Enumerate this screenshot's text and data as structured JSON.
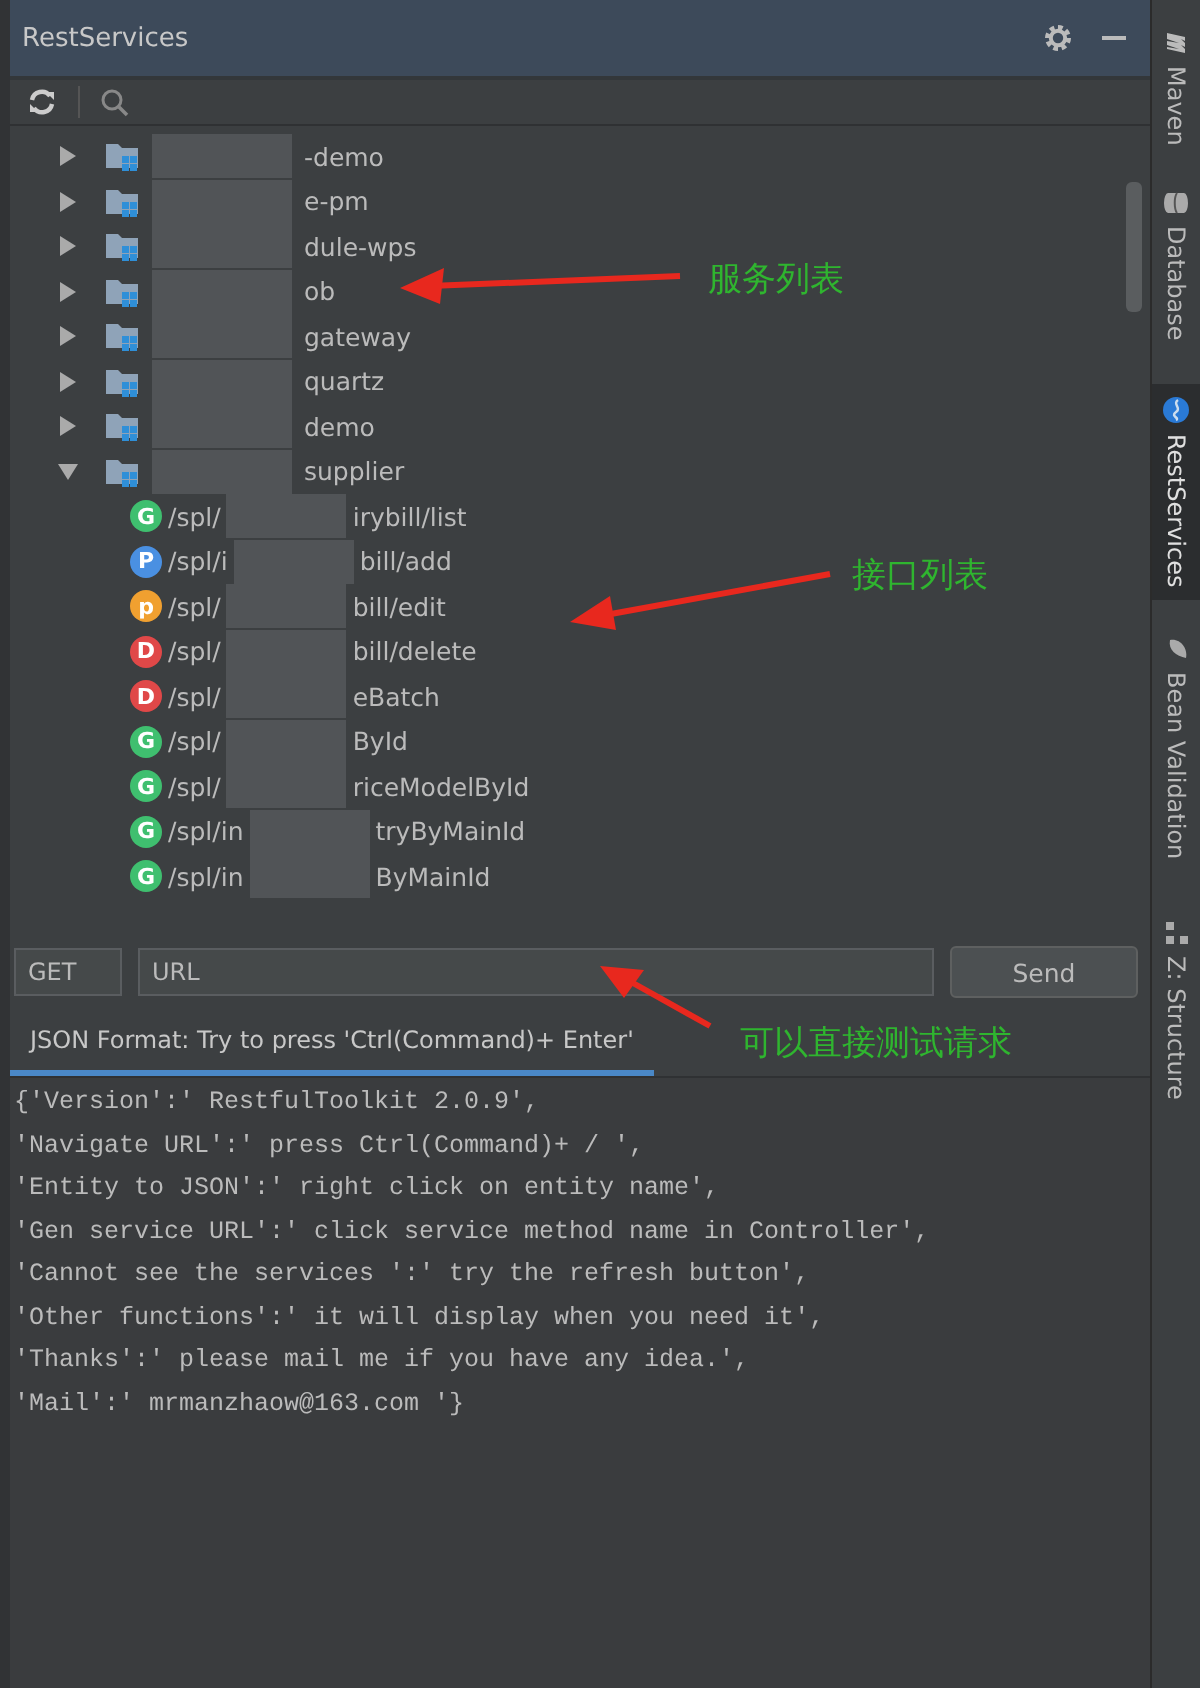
{
  "panel": {
    "title": "RestServices"
  },
  "services": [
    {
      "name": "-demo",
      "expanded": false
    },
    {
      "name": "e-pm",
      "expanded": false
    },
    {
      "name": "dule-wps",
      "expanded": false
    },
    {
      "name": "ob",
      "expanded": false
    },
    {
      "name": "gateway",
      "expanded": false
    },
    {
      "name": "quartz",
      "expanded": false
    },
    {
      "name": "demo",
      "expanded": false
    },
    {
      "name": "supplier",
      "expanded": true,
      "children": [
        {
          "method": "G",
          "path_start": "/spl/",
          "path_end": "irybill/list"
        },
        {
          "method": "P",
          "path_start": "/spl/i",
          "path_end": "bill/add"
        },
        {
          "method": "p",
          "path_start": "/spl/",
          "path_end": "bill/edit"
        },
        {
          "method": "D",
          "path_start": "/spl/",
          "path_end": "bill/delete"
        },
        {
          "method": "D",
          "path_start": "/spl/",
          "path_end": "eBatch"
        },
        {
          "method": "G",
          "path_start": "/spl/",
          "path_end": "ById"
        },
        {
          "method": "G",
          "path_start": "/spl/",
          "path_end": "riceModelById"
        },
        {
          "method": "G",
          "path_start": "/spl/in",
          "path_end": "tryByMainId"
        },
        {
          "method": "G",
          "path_start": "/spl/in",
          "path_end": "ByMainId"
        }
      ]
    }
  ],
  "request": {
    "method": "GET",
    "url_placeholder": "URL",
    "send": "Send"
  },
  "tabs": [
    {
      "label": "JSON Format: Try to press 'Ctrl(Command)+ Enter'",
      "selected": true
    }
  ],
  "response_lines": [
    "{'Version':' RestfulToolkit 2.0.9',",
    "'Navigate URL':' press Ctrl(Command)+ / ',",
    "'Entity to JSON':' right click on entity name',",
    "'Gen service URL':' click service method name in Controller',",
    "'Cannot see the services ':' try the refresh button',",
    "'Other functions':' it will display when you need it',",
    "'Thanks':' please mail me if you have any idea.',",
    "'Mail':' mrmanzhaow@163.com '}"
  ],
  "annotations": [
    "服务列表",
    "接口列表",
    "可以直接测试请求"
  ],
  "tool_windows": [
    {
      "kind": "maven",
      "label": "Maven",
      "selected": false
    },
    {
      "kind": "database",
      "label": "Database",
      "selected": false
    },
    {
      "kind": "rest",
      "label": "RestServices",
      "selected": true
    },
    {
      "kind": "bean",
      "label": "Bean Validation",
      "selected": false
    },
    {
      "kind": "structure",
      "label": "Z: Structure",
      "selected": false
    }
  ]
}
